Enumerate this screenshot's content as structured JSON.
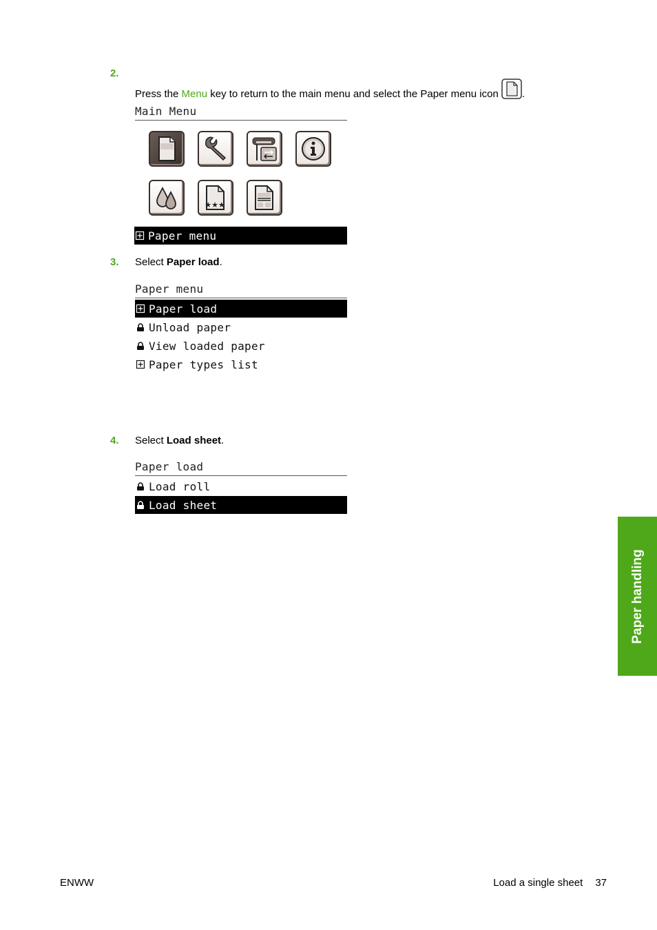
{
  "steps": [
    {
      "number": "2.",
      "text_before": "Press the ",
      "link": "Menu",
      "text_after": " key to return to the main menu and select the Paper menu icon",
      "text_end": ".",
      "inline_icon": "paper-icon"
    },
    {
      "number": "3.",
      "text_before": "Select ",
      "bold": "Paper load",
      "text_after": "."
    },
    {
      "number": "4.",
      "text_before": "Select ",
      "bold": "Load sheet",
      "text_after": "."
    }
  ],
  "main_menu_panel": {
    "title": "Main Menu",
    "icons": [
      {
        "name": "paper-icon",
        "selected": true
      },
      {
        "name": "wrench-icon",
        "selected": false
      },
      {
        "name": "printer-connectivity-icon",
        "selected": false
      },
      {
        "name": "info-icon",
        "selected": false
      },
      {
        "name": "ink-drops-icon",
        "selected": false
      },
      {
        "name": "print-quality-icon",
        "selected": false
      },
      {
        "name": "job-management-icon",
        "selected": false
      }
    ],
    "status_glyph": "plus-box-icon",
    "status_label": "Paper menu"
  },
  "paper_menu_panel": {
    "title": "Paper menu",
    "items": [
      {
        "glyph": "plus-box-icon",
        "label": "Paper load",
        "selected": true
      },
      {
        "glyph": "lock-icon",
        "label": "Unload paper",
        "selected": false
      },
      {
        "glyph": "lock-icon",
        "label": "View loaded paper",
        "selected": false
      },
      {
        "glyph": "plus-box-icon",
        "label": "Paper types list",
        "selected": false
      }
    ]
  },
  "paper_load_panel": {
    "title": "Paper load",
    "items": [
      {
        "glyph": "lock-icon",
        "label": "Load roll",
        "selected": false
      },
      {
        "glyph": "lock-icon",
        "label": "Load sheet",
        "selected": true
      }
    ]
  },
  "side_tab": {
    "label": "Paper handling",
    "color": "#4fa81a"
  },
  "footer": {
    "left": "ENWW",
    "section": "Load a single sheet",
    "page_number": "37"
  },
  "colors": {
    "accent": "#4fa81a",
    "selection_bg": "#000000"
  }
}
